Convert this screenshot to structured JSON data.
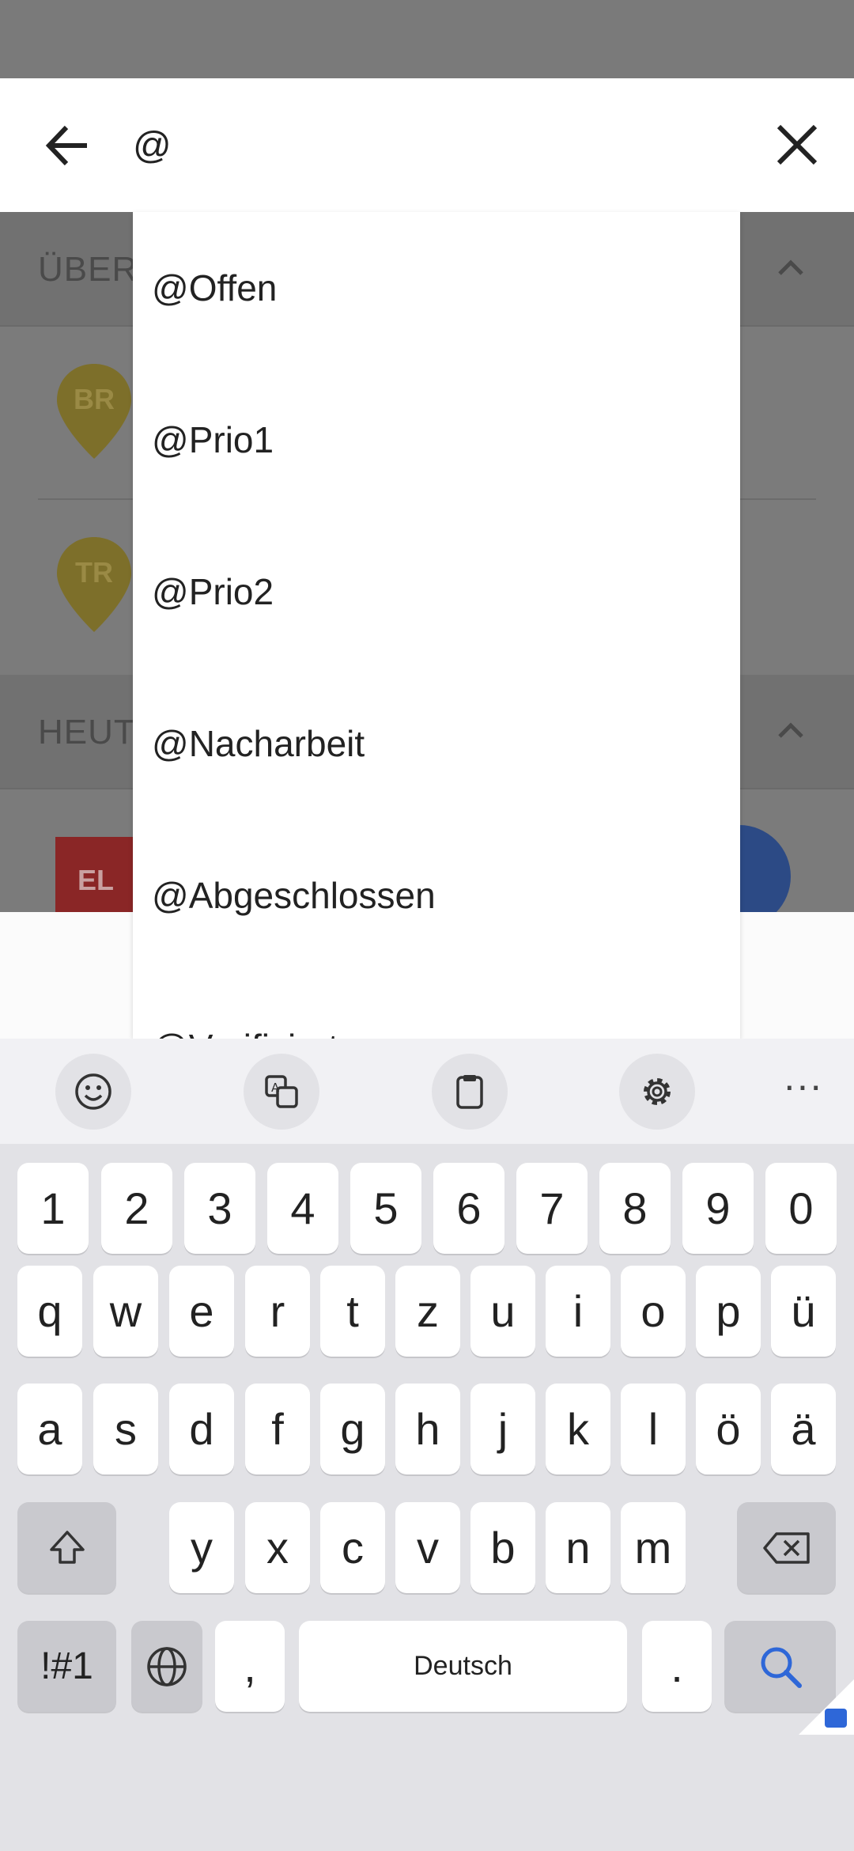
{
  "search": {
    "query": "@"
  },
  "background": {
    "section1_title": "ÜBER",
    "section2_title": "HEUT",
    "pin1_label": "BR",
    "pin2_label": "TR",
    "badge_label": "EL"
  },
  "suggestions": [
    "@Offen",
    "@Prio1",
    "@Prio2",
    "@Nacharbeit",
    "@Abgeschlossen",
    "@Verifiziert"
  ],
  "keyboard": {
    "toolbar": [
      "emoji-icon",
      "translate-icon",
      "clipboard-icon",
      "settings-icon",
      "more-icon"
    ],
    "more_label": "···",
    "row_numbers": [
      "1",
      "2",
      "3",
      "4",
      "5",
      "6",
      "7",
      "8",
      "9",
      "0"
    ],
    "row_1": [
      "q",
      "w",
      "e",
      "r",
      "t",
      "z",
      "u",
      "i",
      "o",
      "p",
      "ü"
    ],
    "row_2": [
      "a",
      "s",
      "d",
      "f",
      "g",
      "h",
      "j",
      "k",
      "l",
      "ö",
      "ä"
    ],
    "row_3": [
      "y",
      "x",
      "c",
      "v",
      "b",
      "n",
      "m"
    ],
    "symbols_label": "!#1",
    "comma_label": ",",
    "space_label": "Deutsch",
    "period_label": ".",
    "accent_color": "#2e67d8"
  }
}
